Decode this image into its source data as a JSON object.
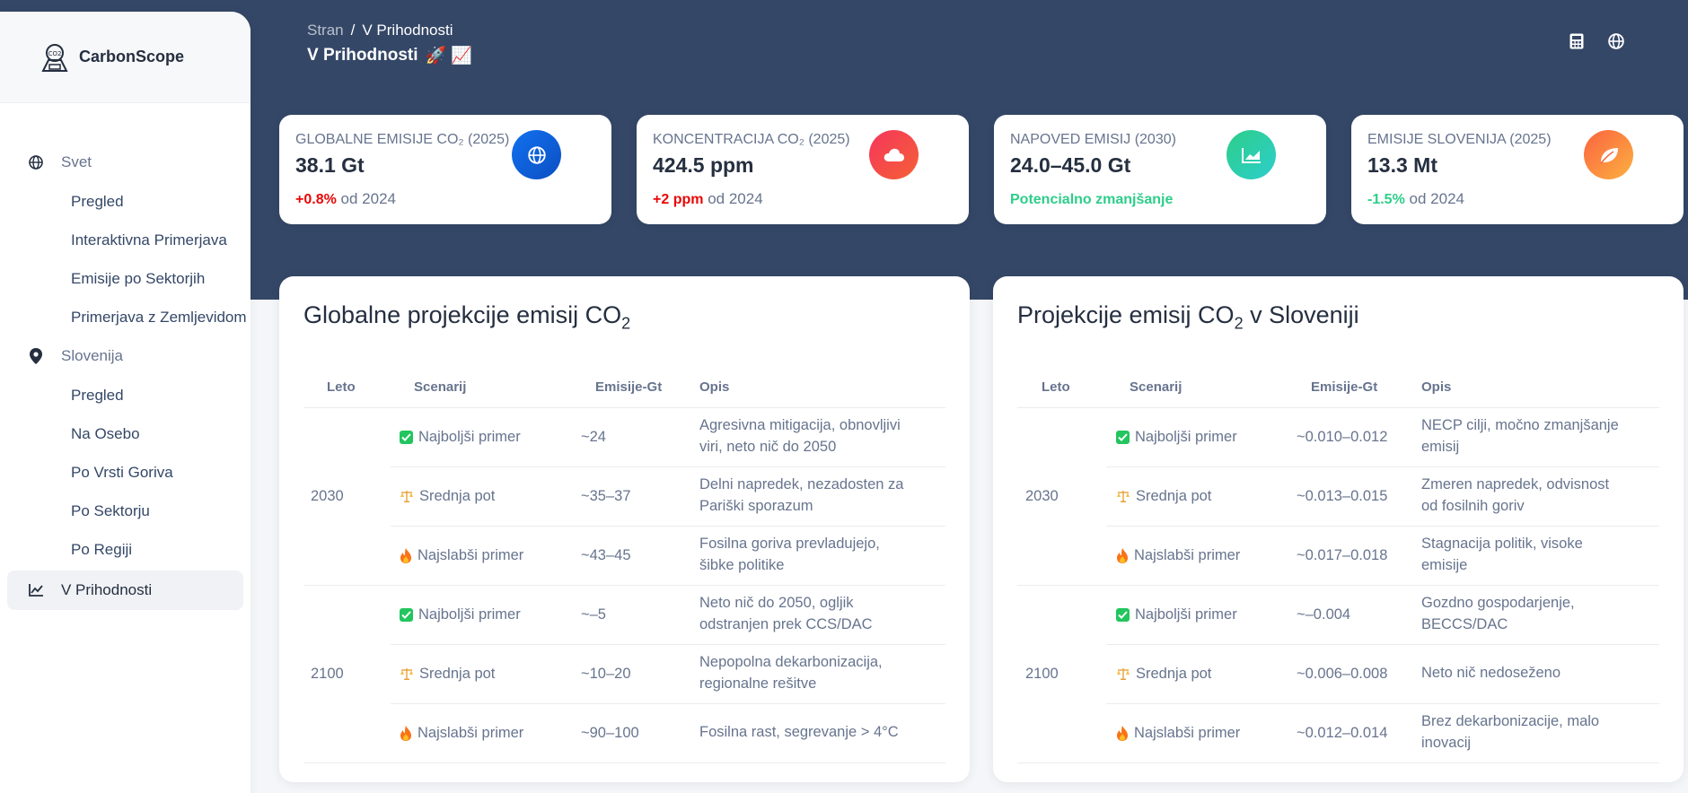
{
  "brand": {
    "name": "CarbonScope"
  },
  "nav": {
    "sections": [
      {
        "label": "Svet",
        "items": [
          "Pregled",
          "Interaktivna Primerjava",
          "Emisije po Sektorjih",
          "Primerjava z Zemljevidom"
        ]
      },
      {
        "label": "Slovenija",
        "items": [
          "Pregled",
          "Na Osebo",
          "Po Vrsti Goriva",
          "Po Sektorju",
          "Po Regiji"
        ]
      }
    ],
    "active": "V Prihodnosti"
  },
  "topbar": {
    "crumb_root": "Stran",
    "crumb_sep": "/",
    "crumb_current": "V Prihodnosti",
    "title": "V Prihodnosti",
    "title_emoji": "🚀 📈"
  },
  "icons": {
    "calculator": "calculator-icon",
    "globe": "globe-icon"
  },
  "colors": {
    "header": "#344767",
    "up": "#ea0606",
    "down": "#22c55e"
  },
  "stats": [
    {
      "label": "GLOBALNE EMISIJE CO₂ (2025)",
      "value": "38.1 Gt",
      "delta": "+0.8%",
      "delta_suffix": "od 2024",
      "color": "#1171ef"
    },
    {
      "label": "KONCENTRACIJA CO₂ (2025)",
      "value": "424.5 ppm",
      "delta": "+2 ppm",
      "delta_suffix": "od 2024",
      "color": "#f5365c"
    },
    {
      "label": "NAPOVED EMISIJ (2030)",
      "value": "24.0–45.0 Gt",
      "delta": "Potencialno zmanjšanje",
      "delta_suffix": "",
      "color": "#2dce89"
    },
    {
      "label": "EMISIJE SLOVENIJA (2025)",
      "value": "13.3 Mt",
      "delta": "-1.5%",
      "delta_suffix": "od 2024",
      "color": "#fb6340"
    }
  ],
  "global_table": {
    "title": "Globalne projekcije emisij CO",
    "title_sub": "2",
    "headers": [
      "Leto",
      "Scenarij",
      "Emisije-Gt",
      "Opis"
    ],
    "groups": [
      {
        "year": "2030",
        "rows": [
          {
            "scenario": "Najboljši primer",
            "kind": "best",
            "value": "~24",
            "desc": "Agresivna mitigacija, obnovljivi viri, neto nič do 2050"
          },
          {
            "scenario": "Srednja pot",
            "kind": "mid",
            "value": "~35–37",
            "desc": "Delni napredek, nezadosten za Pariški sporazum"
          },
          {
            "scenario": "Najslabši primer",
            "kind": "worst",
            "value": "~43–45",
            "desc": "Fosilna goriva prevladujejo, šibke politike"
          }
        ]
      },
      {
        "year": "2100",
        "rows": [
          {
            "scenario": "Najboljši primer",
            "kind": "best",
            "value": "~–5",
            "desc": "Neto nič do 2050, ogljik odstranjen prek CCS/DAC"
          },
          {
            "scenario": "Srednja pot",
            "kind": "mid",
            "value": "~10–20",
            "desc": "Nepopolna dekarbonizacija, regionalne rešitve"
          },
          {
            "scenario": "Najslabši primer",
            "kind": "worst",
            "value": "~90–100",
            "desc": "Fosilna rast, segrevanje > 4°C"
          }
        ]
      }
    ]
  },
  "slo_table": {
    "title": "Projekcije emisij CO",
    "title_sub": "2",
    "title_suffix": " v Sloveniji",
    "headers": [
      "Leto",
      "Scenarij",
      "Emisije-Gt",
      "Opis"
    ],
    "groups": [
      {
        "year": "2030",
        "rows": [
          {
            "scenario": "Najboljši primer",
            "kind": "best",
            "value": "~0.010–0.012",
            "desc": "NECP cilji, močno zmanjšanje emisij"
          },
          {
            "scenario": "Srednja pot",
            "kind": "mid",
            "value": "~0.013–0.015",
            "desc": "Zmeren napredek, odvisnost od fosilnih goriv"
          },
          {
            "scenario": "Najslabši primer",
            "kind": "worst",
            "value": "~0.017–0.018",
            "desc": "Stagnacija politik, visoke emisije"
          }
        ]
      },
      {
        "year": "2100",
        "rows": [
          {
            "scenario": "Najboljši primer",
            "kind": "best",
            "value": "~–0.004",
            "desc": "Gozdno gospodarjenje, BECCS/DAC"
          },
          {
            "scenario": "Srednja pot",
            "kind": "mid",
            "value": "~0.006–0.008",
            "desc": "Neto nič nedoseženo"
          },
          {
            "scenario": "Najslabši primer",
            "kind": "worst",
            "value": "~0.012–0.014",
            "desc": "Brez dekarbonizacije, malo inovacij"
          }
        ]
      }
    ]
  }
}
